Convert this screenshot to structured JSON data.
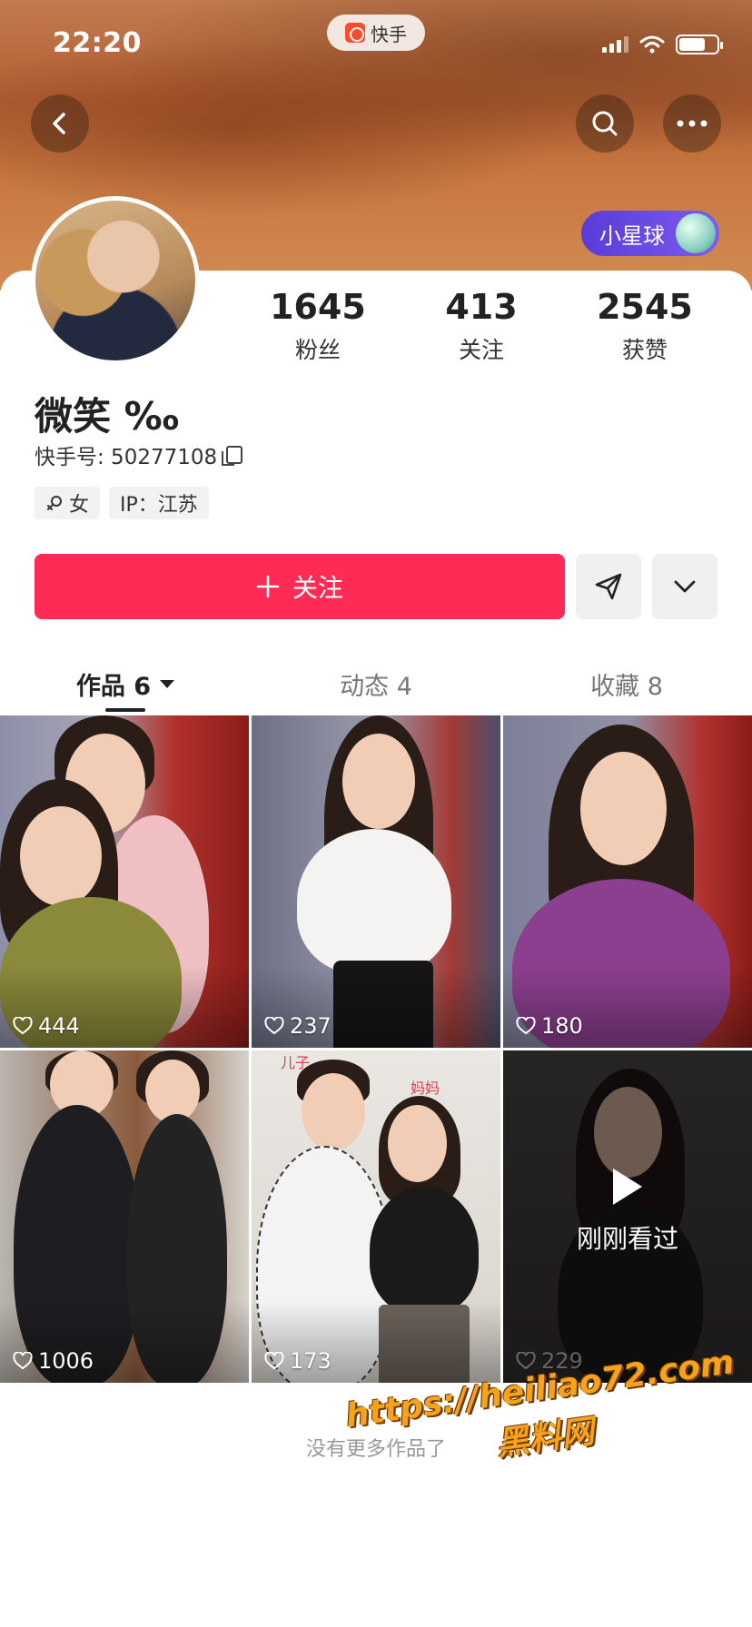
{
  "status_bar": {
    "time": "22:20",
    "app_name": "快手"
  },
  "header": {
    "badge_label": "小星球"
  },
  "profile": {
    "stats": [
      {
        "value": "1645",
        "label": "粉丝"
      },
      {
        "value": "413",
        "label": "关注"
      },
      {
        "value": "2545",
        "label": "获赞"
      }
    ],
    "nickname": "微笑 ‰",
    "id_label": "快手号: 50277108",
    "tags": [
      {
        "icon": "female-icon",
        "label": "女"
      },
      {
        "icon": "",
        "label": "IP：江苏"
      }
    ]
  },
  "actions": {
    "follow_label": "关注",
    "follow_icon": "plus-icon",
    "share_icon": "send-icon",
    "more_icon": "chevron-down-icon"
  },
  "tabs": [
    {
      "label": "作品 6",
      "active": true
    },
    {
      "label": "动态 4",
      "active": false
    },
    {
      "label": "收藏 8",
      "active": false
    }
  ],
  "videos": [
    {
      "likes": "444"
    },
    {
      "likes": "237"
    },
    {
      "likes": "180"
    },
    {
      "likes": "1006"
    },
    {
      "likes": "173",
      "caption_left": "儿子",
      "caption_right": "妈妈"
    },
    {
      "likes": "229",
      "overlay": "刚刚看过"
    }
  ],
  "footer": {
    "end_text": "没有更多作品了"
  },
  "watermark": {
    "line1": "https://heiliao72.com",
    "line2": "黑料网"
  },
  "colors": {
    "accent": "#fe2c55",
    "badge": "#6a4ae4"
  }
}
